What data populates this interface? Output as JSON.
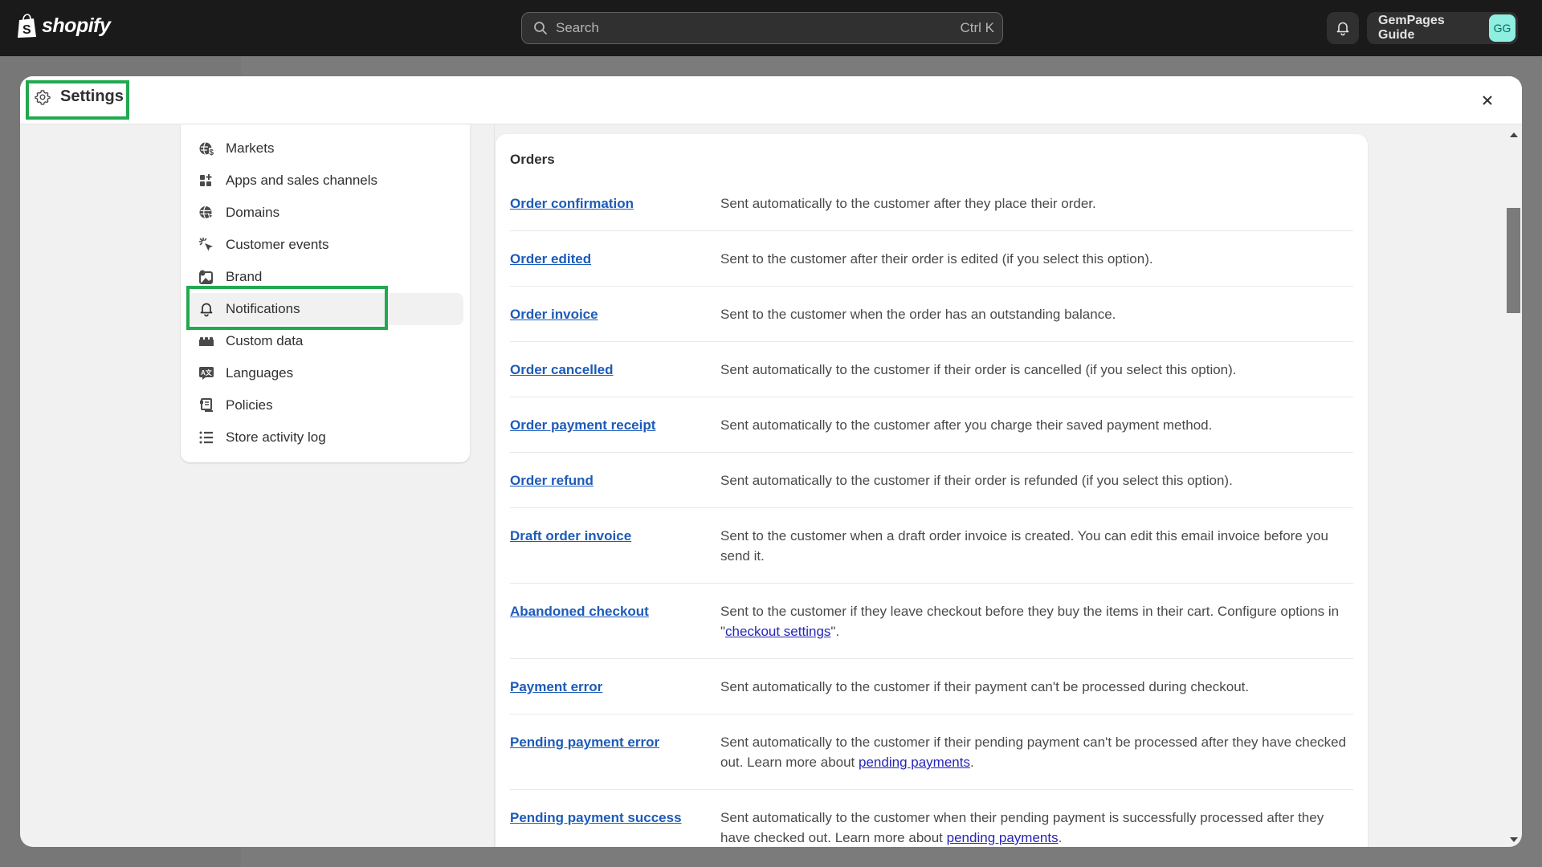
{
  "topbar": {
    "logo_text": "shopify",
    "search_placeholder": "Search",
    "search_shortcut": "Ctrl K",
    "user_name": "GemPages Guide",
    "user_initials": "GG"
  },
  "modal": {
    "title": "Settings"
  },
  "sidebar": {
    "items": [
      {
        "label": "Markets",
        "icon": "globe-dollar-icon",
        "active": false
      },
      {
        "label": "Apps and sales channels",
        "icon": "apps-icon",
        "active": false
      },
      {
        "label": "Domains",
        "icon": "globe-cursor-icon",
        "active": false
      },
      {
        "label": "Customer events",
        "icon": "cursor-click-icon",
        "active": false
      },
      {
        "label": "Brand",
        "icon": "brand-image-icon",
        "active": false
      },
      {
        "label": "Notifications",
        "icon": "bell-icon",
        "active": true
      },
      {
        "label": "Custom data",
        "icon": "custom-data-icon",
        "active": false
      },
      {
        "label": "Languages",
        "icon": "language-icon",
        "active": false
      },
      {
        "label": "Policies",
        "icon": "policy-icon",
        "active": false
      },
      {
        "label": "Store activity log",
        "icon": "list-icon",
        "active": false
      }
    ]
  },
  "content": {
    "section_title": "Orders",
    "rows": [
      {
        "name": "Order confirmation",
        "desc": "Sent automatically to the customer after they place their order."
      },
      {
        "name": "Order edited",
        "desc": "Sent to the customer after their order is edited (if you select this option)."
      },
      {
        "name": "Order invoice",
        "desc": "Sent to the customer when the order has an outstanding balance."
      },
      {
        "name": "Order cancelled",
        "desc": "Sent automatically to the customer if their order is cancelled (if you select this option)."
      },
      {
        "name": "Order payment receipt",
        "desc": "Sent automatically to the customer after you charge their saved payment method."
      },
      {
        "name": "Order refund",
        "desc": "Sent automatically to the customer if their order is refunded (if you select this option)."
      },
      {
        "name": "Draft order invoice",
        "desc": "Sent to the customer when a draft order invoice is created. You can edit this email invoice before you send it."
      },
      {
        "name": "Abandoned checkout",
        "desc_before": "Sent to the customer if they leave checkout before they buy the items in their cart. Configure options in \"",
        "desc_link": "checkout settings",
        "desc_after": "\"."
      },
      {
        "name": "Payment error",
        "desc": "Sent automatically to the customer if their payment can't be processed during checkout."
      },
      {
        "name": "Pending payment error",
        "desc_before": "Sent automatically to the customer if their pending payment can't be processed after they have checked out. Learn more about ",
        "desc_link": "pending payments",
        "desc_after": "."
      },
      {
        "name": "Pending payment success",
        "desc_before": "Sent automatically to the customer when their pending payment is successfully processed after they have checked out. Learn more about ",
        "desc_link": "pending payments",
        "desc_after": "."
      }
    ]
  },
  "colors": {
    "highlight": "#22a94f",
    "link": "#1d5bb8",
    "avatar_bg": "#8eeee0"
  }
}
